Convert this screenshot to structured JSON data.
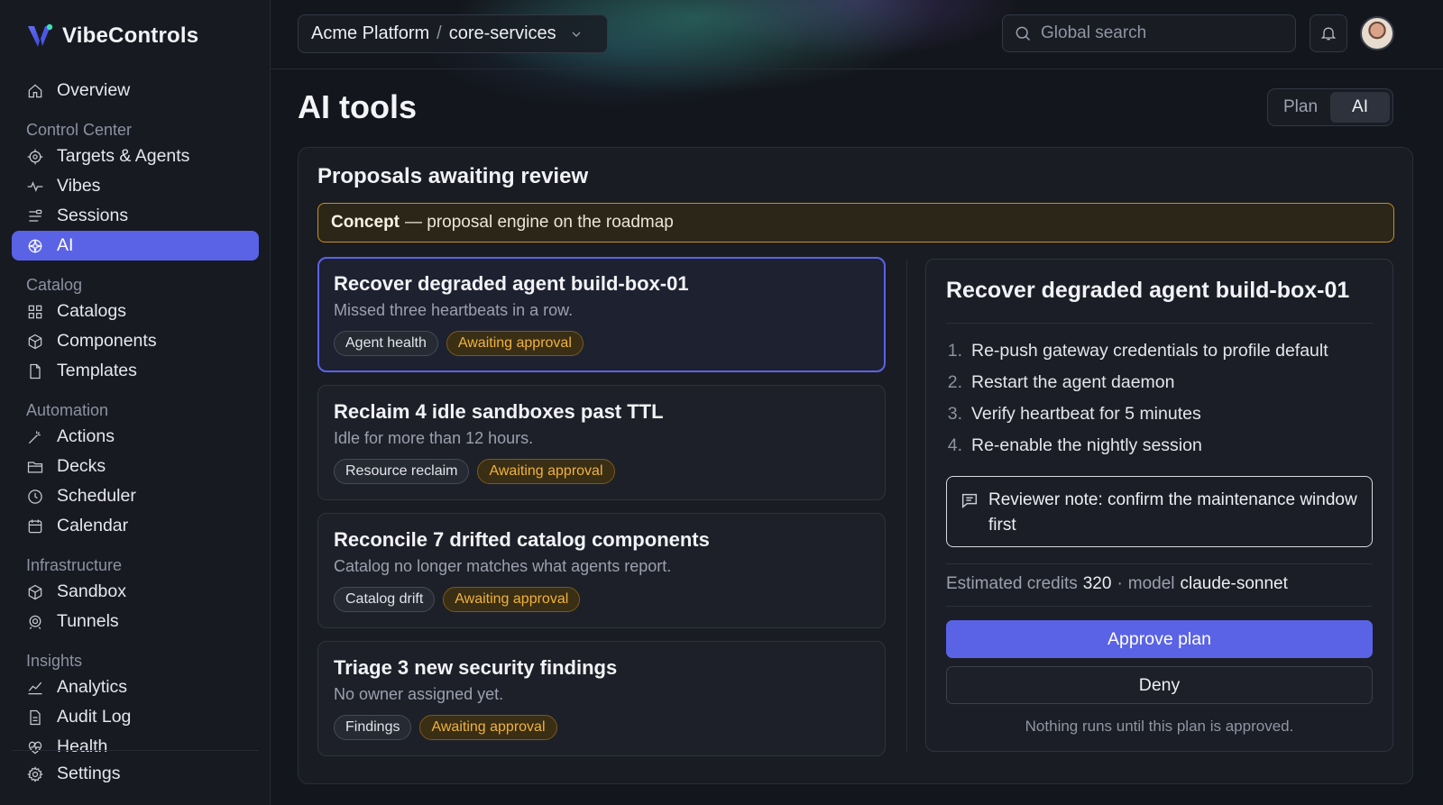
{
  "brand": {
    "name": "VibeControls",
    "accent": "#5a63e6"
  },
  "sidebar": {
    "overview": "Overview",
    "sections": {
      "control_center": "Control Center",
      "catalog": "Catalog",
      "automation": "Automation",
      "infrastructure": "Infrastructure",
      "insights": "Insights"
    },
    "items": {
      "targets_agents": "Targets & Agents",
      "vibes": "Vibes",
      "sessions": "Sessions",
      "ai": "AI",
      "catalogs": "Catalogs",
      "components": "Components",
      "templates": "Templates",
      "actions": "Actions",
      "decks": "Decks",
      "scheduler": "Scheduler",
      "calendar": "Calendar",
      "sandbox": "Sandbox",
      "tunnels": "Tunnels",
      "analytics": "Analytics",
      "audit_log": "Audit Log",
      "health": "Health"
    },
    "settings": "Settings",
    "active": "AI"
  },
  "header": {
    "breadcrumb": {
      "org": "Acme Platform",
      "separator": "/",
      "project": "core-services"
    },
    "search": {
      "placeholder": "Global search",
      "value": ""
    }
  },
  "page": {
    "title": "AI tools",
    "toggle": {
      "plan": "Plan",
      "ai": "AI",
      "selected": "AI"
    }
  },
  "panel": {
    "title": "Proposals awaiting review",
    "concept": {
      "label": "Concept",
      "text": "— proposal engine on the roadmap"
    },
    "proposals": [
      {
        "title": "Recover degraded agent build-box-01",
        "subtitle": "Missed three heartbeats in a row.",
        "tag": "Agent health",
        "status": "Awaiting approval",
        "selected": true
      },
      {
        "title": "Reclaim 4 idle sandboxes past TTL",
        "subtitle": "Idle for more than 12 hours.",
        "tag": "Resource reclaim",
        "status": "Awaiting approval",
        "selected": false
      },
      {
        "title": "Reconcile 7 drifted catalog components",
        "subtitle": "Catalog no longer matches what agents report.",
        "tag": "Catalog drift",
        "status": "Awaiting approval",
        "selected": false
      },
      {
        "title": "Triage 3 new security findings",
        "subtitle": "No owner assigned yet.",
        "tag": "Findings",
        "status": "Awaiting approval",
        "selected": false
      }
    ]
  },
  "detail": {
    "title": "Recover degraded agent build-box-01",
    "steps": [
      {
        "num": "1.",
        "text": "Re-push gateway credentials to profile default"
      },
      {
        "num": "2.",
        "text": "Restart the agent daemon"
      },
      {
        "num": "3.",
        "text": "Verify heartbeat for 5 minutes"
      },
      {
        "num": "4.",
        "text": "Re-enable the nightly session"
      }
    ],
    "note": "Reviewer note: confirm the maintenance window first",
    "credits_label": "Estimated credits",
    "credits_value": "320",
    "dot": "·",
    "model_label": "model",
    "model_value": "claude-sonnet",
    "approve": "Approve plan",
    "deny": "Deny",
    "footnote": "Nothing runs until this plan is approved."
  },
  "colors": {
    "warning": "#f0b23c",
    "concept_border": "#c9901f",
    "background": "#14161d"
  }
}
